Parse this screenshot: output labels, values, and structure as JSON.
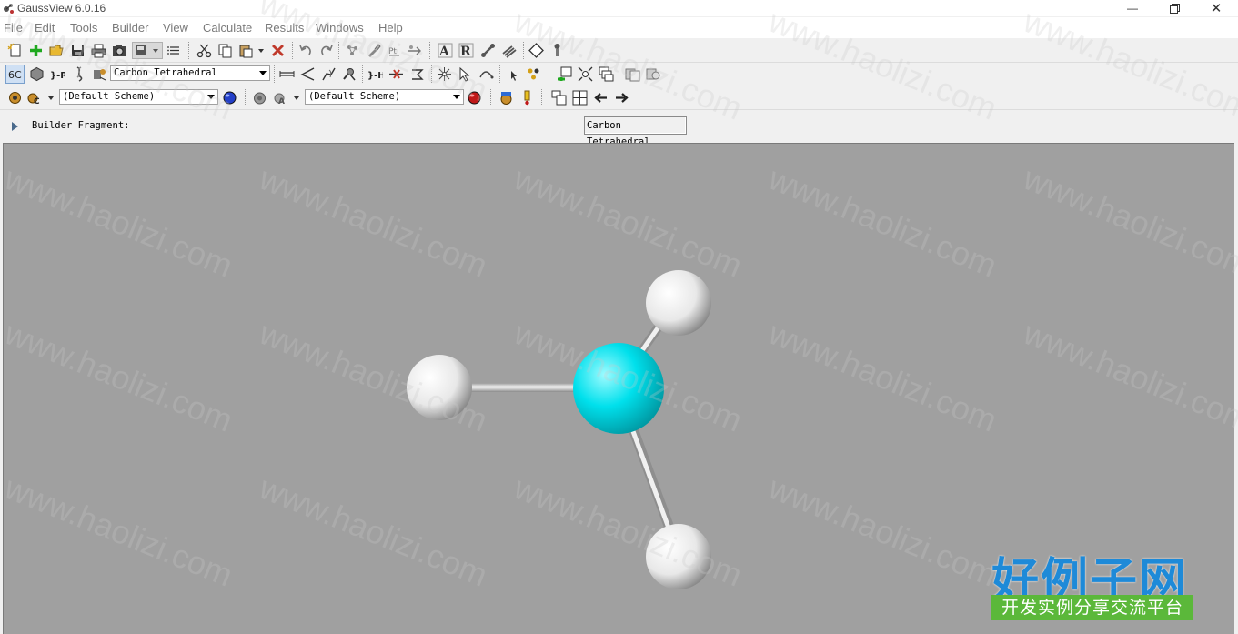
{
  "window": {
    "title": "GaussView 6.0.16"
  },
  "menu": [
    "File",
    "Edit",
    "Tools",
    "Builder",
    "View",
    "Calculate",
    "Results",
    "Windows",
    "Help"
  ],
  "toolbar2": {
    "fragment_combo": "Carbon Tetrahedral"
  },
  "toolbar3": {
    "scheme_combo_1": "(Default Scheme)",
    "scheme_combo_2": "(Default Scheme)"
  },
  "builder": {
    "label": "Builder Fragment:",
    "fragment": "Carbon Tetrahedral"
  },
  "molecule": {
    "center_atom_color": "#00e0ec",
    "hydrogen_color": "#f2f2f2",
    "bond_color": "#e6e6e6",
    "viewport_bg": "#a0a0a0"
  },
  "watermark": {
    "text": "www.haolizi.com",
    "brand_title": "好例子网",
    "brand_sub": "开发实例分享交流平台"
  }
}
